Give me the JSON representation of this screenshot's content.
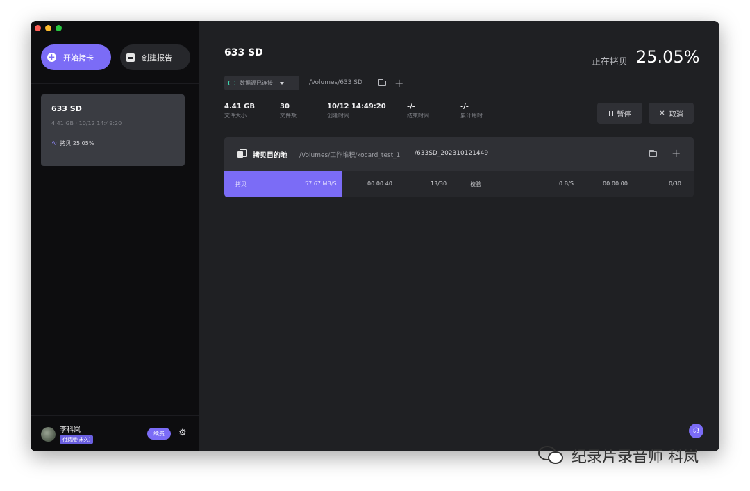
{
  "colors": {
    "accent": "#7b6cf6",
    "background": "#1f2023",
    "sidebar": "#0d0d0f",
    "connected": "#3fd7b0"
  },
  "sidebar": {
    "start_button": "开始拷卡",
    "report_button": "创建报告",
    "job": {
      "title": "633 SD",
      "meta": "4.41 GB · 10/12 14:49:20",
      "status": "拷贝 25.05%"
    },
    "user": {
      "name": "李科岚",
      "plan": "付费版(永久)",
      "renew_button": "续费"
    }
  },
  "main": {
    "title": "633 SD",
    "progress_label": "正在拷贝",
    "progress_value": "25.05%",
    "source": {
      "dropdown_label": "数据源已连接",
      "path": "/Volumes/633 SD"
    },
    "stats": [
      {
        "value": "4.41 GB",
        "label": "文件大小"
      },
      {
        "value": "30",
        "label": "文件数"
      },
      {
        "value": "10/12 14:49:20",
        "label": "创建时间"
      },
      {
        "value": "-/-",
        "label": "结束时间"
      },
      {
        "value": "-/-",
        "label": "累计用时"
      }
    ],
    "pause_button": "暂停",
    "cancel_button": "取消",
    "destination": {
      "label": "拷贝目的地",
      "path_prefix": "/Volumes/工作堆积/kocard_test_1",
      "path_suffix": "/633SD_2023101214­49",
      "copy": {
        "label": "拷贝",
        "speed": "57.67 MB/S",
        "elapsed": "00:00:40",
        "count": "13/30",
        "progress_fraction": 0.5
      },
      "verify": {
        "label": "校验",
        "speed": "0 B/S",
        "elapsed": "00:00:00",
        "count": "0/30"
      }
    }
  },
  "watermark": "纪录片录音师 科岚"
}
